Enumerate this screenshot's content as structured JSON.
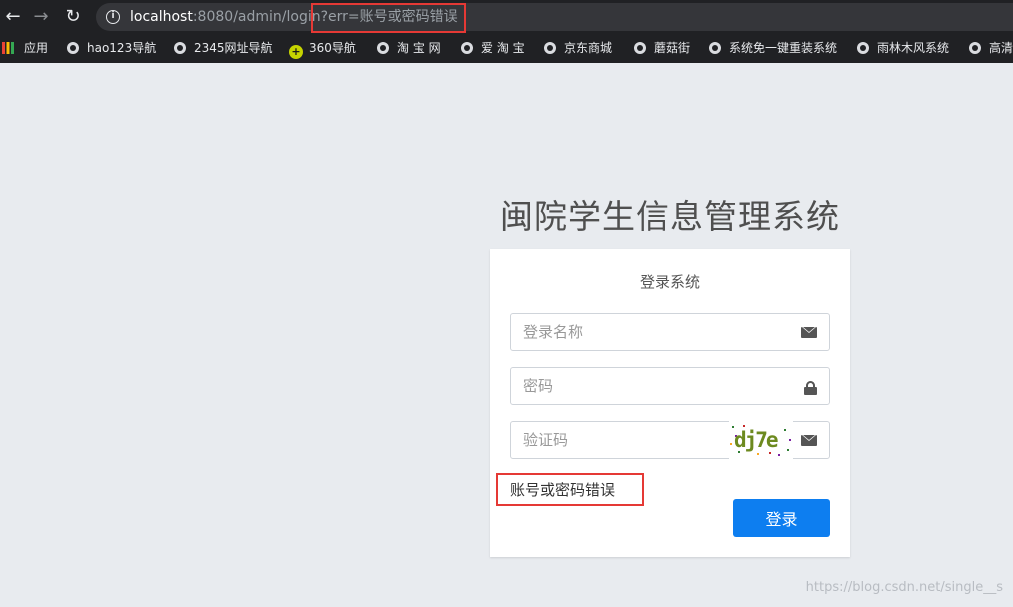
{
  "browser": {
    "nav": {
      "back": "←",
      "forward": "→",
      "reload": "↻"
    },
    "url_host": "localhost",
    "url_rest": ":8080/admin/login?err=账号或密码错误",
    "bookmarks": [
      {
        "label": "应用",
        "icon": "apps-icon"
      },
      {
        "label": "hao123导航",
        "icon": "globe-icon"
      },
      {
        "label": "2345网址导航",
        "icon": "globe-icon"
      },
      {
        "label": "360导航",
        "icon": "plus-icon"
      },
      {
        "label": "淘 宝 网",
        "icon": "globe-icon"
      },
      {
        "label": "爱 淘 宝",
        "icon": "globe-icon"
      },
      {
        "label": "京东商城",
        "icon": "globe-icon"
      },
      {
        "label": "蘑菇街",
        "icon": "globe-icon"
      },
      {
        "label": "系统免一键重装系统",
        "icon": "globe-icon"
      },
      {
        "label": "雨林木风系统",
        "icon": "globe-icon"
      },
      {
        "label": "高清",
        "icon": "globe-icon"
      }
    ]
  },
  "page": {
    "title": "闽院学生信息管理系统",
    "card_title": "登录系统",
    "username_placeholder": "登录名称",
    "password_placeholder": "密码",
    "captcha_placeholder": "验证码",
    "captcha_text": "dj7e",
    "error_text": "账号或密码错误",
    "login_label": "登录"
  },
  "colors": {
    "highlight": "#e53935",
    "primary_button": "#0d7ef0",
    "page_background": "#e8ebef"
  },
  "watermark": "https://blog.csdn.net/single__s"
}
